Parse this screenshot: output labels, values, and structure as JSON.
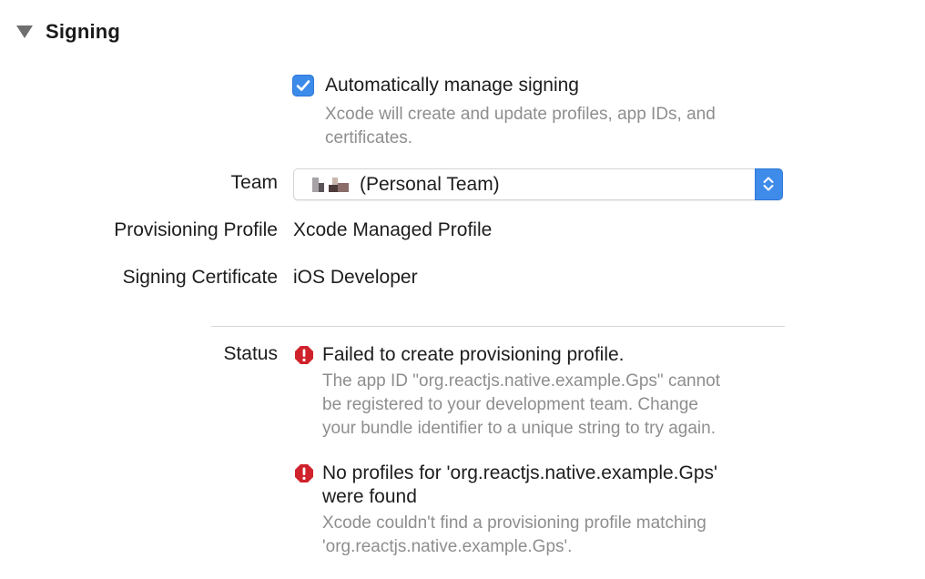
{
  "section": {
    "title": "Signing",
    "disclosure_icon": "disclosure-triangle-down"
  },
  "auto_signing": {
    "checked": true,
    "label": "Automatically manage signing",
    "help_line1": "Xcode will create and update profiles, app IDs, and",
    "help_line2": "certificates."
  },
  "team": {
    "label": "Team",
    "value": "(Personal Team)"
  },
  "provisioning_profile": {
    "label": "Provisioning Profile",
    "value": "Xcode Managed Profile"
  },
  "signing_certificate": {
    "label": "Signing Certificate",
    "value": "iOS Developer"
  },
  "status": {
    "label": "Status",
    "errors": [
      {
        "icon": "error-icon",
        "title_line1": "Failed to create provisioning profile.",
        "title_line2": "",
        "detail_line1": "The app ID \"org.reactjs.native.example.Gps\" cannot",
        "detail_line2": "be registered to your development team. Change",
        "detail_line3": "your bundle identifier to a unique string to try again."
      },
      {
        "icon": "error-icon",
        "title_line1": "No profiles for 'org.reactjs.native.example.Gps'",
        "title_line2": "were found",
        "detail_line1": "Xcode couldn't find a provisioning profile matching",
        "detail_line2": "'org.reactjs.native.example.Gps'."
      }
    ]
  },
  "colors": {
    "accent": "#3c8bea",
    "error": "#d0222b",
    "helper_text": "#8e8e8e",
    "divider": "#d6d6d6"
  }
}
